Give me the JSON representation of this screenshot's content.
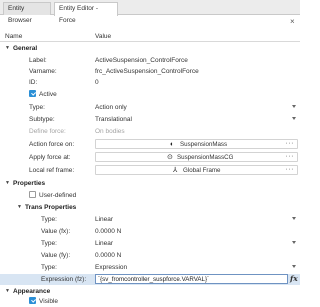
{
  "tabs": [
    "Entity Browser",
    "Entity Editor - Force"
  ],
  "columns": {
    "name": "Name",
    "value": "Value"
  },
  "sections": {
    "general": "General",
    "properties": "Properties",
    "trans_properties": "Trans Properties",
    "appearance": "Appearance"
  },
  "general": {
    "label": {
      "name": "Label:",
      "value": "ActiveSuspension_ControlForce"
    },
    "varname": {
      "name": "Varname:",
      "value": "frc_ActiveSuspension_ControlForce"
    },
    "id": {
      "name": "ID:",
      "value": "0"
    },
    "active": {
      "name": "Active",
      "checked": true
    },
    "type": {
      "name": "Type:",
      "value": "Action only"
    },
    "subtype": {
      "name": "Subtype:",
      "value": "Translational"
    },
    "define_force": {
      "name": "Define force:",
      "value": "On bodies"
    },
    "action_force_on": {
      "name": "Action force on:",
      "value": "SuspensionMass",
      "icon": "body-icon"
    },
    "apply_force_at": {
      "name": "Apply force at:",
      "value": "SuspensionMassCG",
      "icon": "point-icon"
    },
    "local_ref_frame": {
      "name": "Local ref frame:",
      "value": "Global Frame",
      "icon": "frame-icon"
    }
  },
  "properties": {
    "user_defined": {
      "name": "User-defined",
      "checked": false
    }
  },
  "trans_properties": [
    {
      "name": "Type:",
      "value": "Linear"
    },
    {
      "name": "Value (fx):",
      "value": "0.0000 N"
    },
    {
      "name": "Type:",
      "value": "Linear"
    },
    {
      "name": "Value (fy):",
      "value": "0.0000 N"
    },
    {
      "name": "Type:",
      "value": "Expression"
    },
    {
      "name": "Expression (fz):",
      "value": "`{sv_fromcontroller_suspforce.VARVAL}`"
    }
  ],
  "appearance": {
    "visible": {
      "name": "Visible",
      "checked": true
    }
  },
  "icons": {
    "close": "×",
    "more": "···",
    "fx": "fx"
  },
  "colors": {
    "checkbox": "#2b8fd6",
    "selection": "#d8e5f3"
  }
}
